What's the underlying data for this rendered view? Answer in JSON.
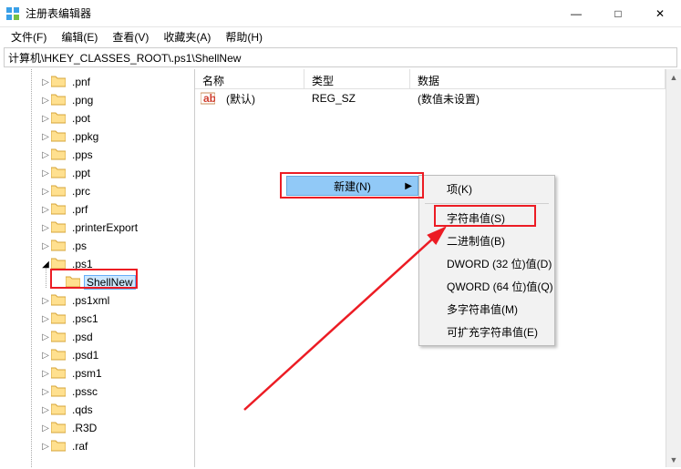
{
  "window": {
    "title": "注册表编辑器",
    "min": "—",
    "max": "□",
    "close": "✕"
  },
  "menu": {
    "file": "文件(F)",
    "edit": "编辑(E)",
    "view": "查看(V)",
    "fav": "收藏夹(A)",
    "help": "帮助(H)"
  },
  "address": "计算机\\HKEY_CLASSES_ROOT\\.ps1\\ShellNew",
  "arrow_up": "▲",
  "arrow_down": "▼",
  "tree": [
    {
      "label": ".pnf",
      "indent": "indent2"
    },
    {
      "label": ".png",
      "indent": "indent2"
    },
    {
      "label": ".pot",
      "indent": "indent2"
    },
    {
      "label": ".ppkg",
      "indent": "indent2"
    },
    {
      "label": ".pps",
      "indent": "indent2"
    },
    {
      "label": ".ppt",
      "indent": "indent2"
    },
    {
      "label": ".prc",
      "indent": "indent2"
    },
    {
      "label": ".prf",
      "indent": "indent2"
    },
    {
      "label": ".printerExport",
      "indent": "indent2"
    },
    {
      "label": ".ps",
      "indent": "indent2"
    },
    {
      "label": ".ps1",
      "indent": "indent2",
      "expanded": true
    },
    {
      "label": "ShellNew",
      "indent": "indent3",
      "selected": true
    },
    {
      "label": ".ps1xml",
      "indent": "indent2"
    },
    {
      "label": ".psc1",
      "indent": "indent2"
    },
    {
      "label": ".psd",
      "indent": "indent2"
    },
    {
      "label": ".psd1",
      "indent": "indent2"
    },
    {
      "label": ".psm1",
      "indent": "indent2"
    },
    {
      "label": ".pssc",
      "indent": "indent2"
    },
    {
      "label": ".qds",
      "indent": "indent2"
    },
    {
      "label": ".R3D",
      "indent": "indent2"
    },
    {
      "label": ".raf",
      "indent": "indent2"
    }
  ],
  "list": {
    "headers": {
      "name": "名称",
      "type": "类型",
      "data": "数据"
    },
    "rows": [
      {
        "name": "(默认)",
        "type": "REG_SZ",
        "data": "(数值未设置)"
      }
    ]
  },
  "contextmenu": {
    "parent": {
      "label": "新建(N)",
      "arrow": "▶"
    },
    "items": [
      {
        "label": "项(K)"
      },
      {
        "label": "字符串值(S)",
        "hl": true
      },
      {
        "label": "二进制值(B)"
      },
      {
        "label": "DWORD (32 位)值(D)"
      },
      {
        "label": "QWORD (64 位)值(Q)"
      },
      {
        "label": "多字符串值(M)"
      },
      {
        "label": "可扩充字符串值(E)"
      }
    ]
  }
}
